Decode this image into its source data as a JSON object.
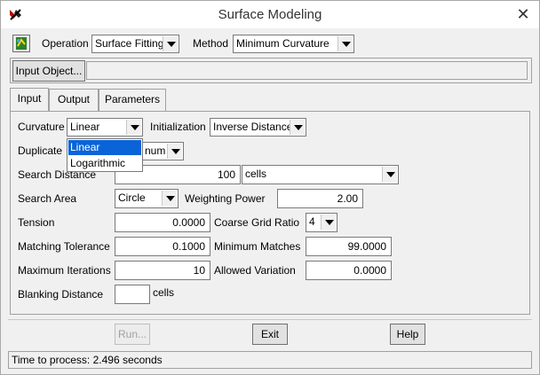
{
  "window": {
    "title": "Surface Modeling",
    "close_glyph": "✕",
    "app_icon": "app-logo-icon"
  },
  "toolbar": {
    "operation_label": "Operation",
    "operation_value": "Surface Fitting",
    "method_label": "Method",
    "method_value": "Minimum Curvature",
    "input_object_button": "Input Object...",
    "input_object_value": ""
  },
  "tabs": [
    {
      "label": "Input"
    },
    {
      "label": "Output"
    },
    {
      "label": "Parameters"
    }
  ],
  "params": {
    "curvature_label": "Curvature",
    "curvature_value": "Linear",
    "initialization_label": "Initialization",
    "initialization_value": "Inverse Distance",
    "duplicate_label": "Duplicate",
    "duplicate_value": "Minimum",
    "duplicate_value_visible": "num",
    "search_distance_label": "Search Distance",
    "search_distance_value": "100",
    "search_distance_unit": "cells",
    "search_area_label": "Search Area",
    "search_area_value": "Circle",
    "weighting_power_label": "Weighting Power",
    "weighting_power_value": "2.00",
    "tension_label": "Tension",
    "tension_value": "0.0000",
    "coarse_grid_label": "Coarse Grid Ratio",
    "coarse_grid_value": "4",
    "matching_tolerance_label": "Matching Tolerance",
    "matching_tolerance_value": "0.1000",
    "minimum_matches_label": "Minimum Matches",
    "minimum_matches_value": "99.0000",
    "max_iterations_label": "Maximum Iterations",
    "max_iterations_value": "10",
    "allowed_variation_label": "Allowed Variation",
    "allowed_variation_value": "0.0000",
    "blanking_distance_label": "Blanking Distance",
    "blanking_distance_value": "",
    "blanking_unit": "cells"
  },
  "curvature_dropdown": {
    "options": [
      "Linear",
      "Logarithmic"
    ],
    "selected_index": 0
  },
  "buttons": {
    "run": "Run...",
    "exit": "Exit",
    "help": "Help"
  },
  "status": {
    "text": "Time to process: 2.496 seconds"
  },
  "colors": {
    "selection": "#0a64d8",
    "window_bg": "#f0f0f0"
  }
}
